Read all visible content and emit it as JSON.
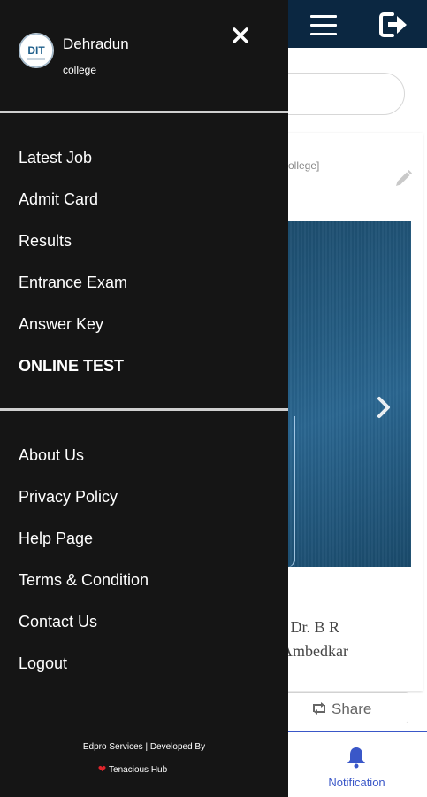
{
  "drawer": {
    "org_name": "Dehradun",
    "org_sub": "college",
    "avatar_text": "DIT",
    "primary_items": [
      {
        "label": "Latest Job"
      },
      {
        "label": "Admit Card"
      },
      {
        "label": "Results"
      },
      {
        "label": "Entrance Exam"
      },
      {
        "label": "Answer Key"
      },
      {
        "label": "ONLINE TEST"
      }
    ],
    "secondary_items": [
      {
        "label": "About Us"
      },
      {
        "label": "Privacy Policy"
      },
      {
        "label": "Help Page"
      },
      {
        "label": "Terms & Condition"
      },
      {
        "label": "Contact Us"
      },
      {
        "label": "Logout"
      }
    ],
    "footer": {
      "credit": "Edpro Services | Developed By",
      "developer": "Tenacious Hub"
    }
  },
  "background": {
    "post_subtitle": "college]",
    "post_text_line1": "r Dr. B R",
    "post_text_line2": "Ambedkar",
    "share_label": "Share",
    "notification_label": "Notification"
  },
  "colors": {
    "drawer_bg": "#151515",
    "header_bg": "#0b2741",
    "accent": "#3a57c8",
    "heart": "#e0242b"
  },
  "icons": [
    "close-icon",
    "menu-icon",
    "exit-icon",
    "edit-icon",
    "chevron-right-icon",
    "share-icon",
    "bell-icon",
    "heart-icon"
  ]
}
